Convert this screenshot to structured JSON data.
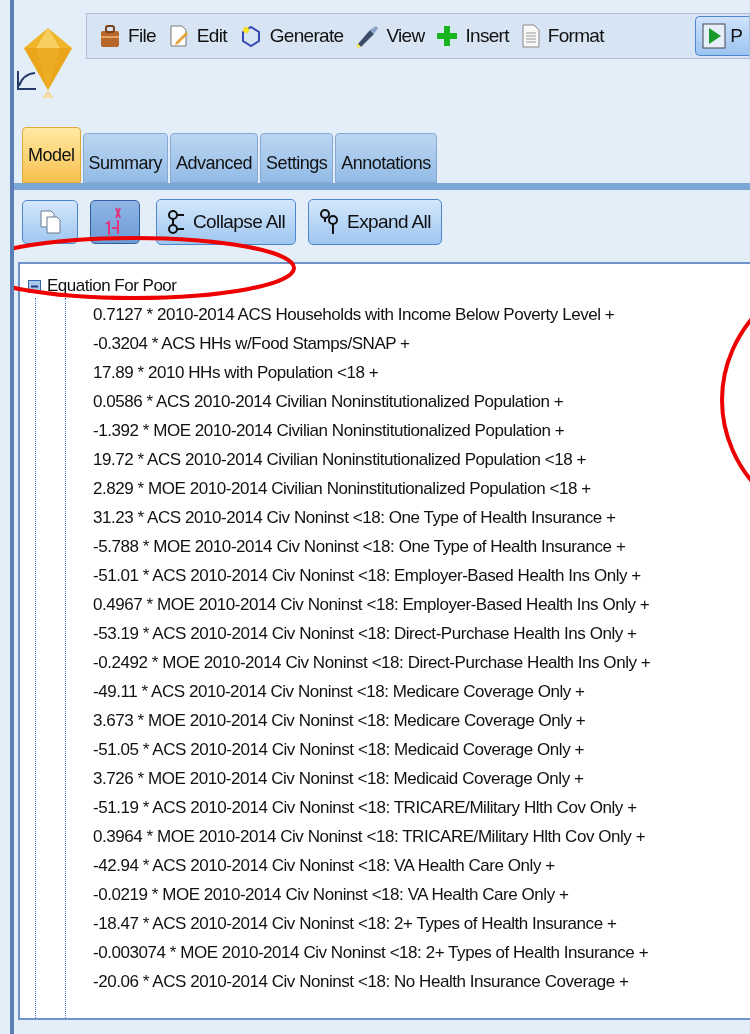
{
  "menu": [
    {
      "label": "File",
      "kind": "bag"
    },
    {
      "label": "Edit",
      "kind": "edit"
    },
    {
      "label": "Generate",
      "kind": "generate"
    },
    {
      "label": "View",
      "kind": "view"
    },
    {
      "label": "Insert",
      "kind": "insert"
    },
    {
      "label": "Format",
      "kind": "format"
    },
    {
      "label": "P",
      "kind": "preview"
    }
  ],
  "tabs": [
    {
      "label": "Model",
      "selected": true
    },
    {
      "label": "Summary",
      "selected": false
    },
    {
      "label": "Advanced",
      "selected": false
    },
    {
      "label": "Settings",
      "selected": false
    },
    {
      "label": "Annotations",
      "selected": false
    }
  ],
  "toolbar": [
    {
      "kind": "copy",
      "pressed": false
    },
    {
      "kind": "sort",
      "pressed": true
    },
    {
      "kind": "collapse",
      "label": "Collapse All"
    },
    {
      "kind": "expand",
      "label": "Expand All"
    }
  ],
  "tree": {
    "label": "Equation For Poor",
    "expanded": true,
    "children": [
      "0.7127 * 2010-2014 ACS Households with Income Below Poverty Level +",
      "-0.3204 * ACS HHs w/Food Stamps/SNAP +",
      "17.89 * 2010 HHs with Population <18 +",
      "0.0586 * ACS 2010-2014 Civilian Noninstitutionalized Population +",
      "-1.392 * MOE 2010-2014 Civilian Noninstitutionalized Population +",
      "19.72 * ACS 2010-2014 Civilian Noninstitutionalized Population <18 +",
      "2.829 * MOE 2010-2014 Civilian Noninstitutionalized Population <18 +",
      "31.23 * ACS 2010-2014 Civ Noninst <18: One Type of Health Insurance +",
      "-5.788 * MOE 2010-2014 Civ Noninst <18: One Type of Health Insurance +",
      "-51.01 * ACS 2010-2014 Civ Noninst <18: Employer-Based Health Ins Only +",
      "0.4967 * MOE 2010-2014 Civ Noninst <18: Employer-Based Health Ins Only +",
      "-53.19 * ACS 2010-2014 Civ Noninst <18: Direct-Purchase Health Ins Only +",
      "-0.2492 * MOE 2010-2014 Civ Noninst <18: Direct-Purchase Health Ins Only +",
      "-49.11 * ACS 2010-2014 Civ Noninst <18: Medicare Coverage Only +",
      "3.673 * MOE 2010-2014 Civ Noninst <18: Medicare Coverage Only +",
      "-51.05 * ACS 2010-2014 Civ Noninst <18: Medicaid Coverage Only +",
      "3.726 * MOE 2010-2014 Civ Noninst <18: Medicaid Coverage Only +",
      "-51.19 * ACS 2010-2014 Civ Noninst <18: TRICARE/Military Hlth Cov Only +",
      "0.3964 * MOE 2010-2014 Civ Noninst <18: TRICARE/Military Hlth Cov Only +",
      "-42.94 * ACS 2010-2014 Civ Noninst <18: VA Health Care Only +",
      "-0.0219 * MOE 2010-2014 Civ Noninst <18: VA Health Care Only +",
      "-18.47 * ACS 2010-2014 Civ Noninst <18: 2+ Types of Health Insurance +",
      "-0.003074 * MOE 2010-2014 Civ Noninst <18: 2+ Types of Health Insurance +",
      "-20.06 * ACS 2010-2014 Civ Noninst <18: No Health Insurance Coverage +"
    ]
  }
}
